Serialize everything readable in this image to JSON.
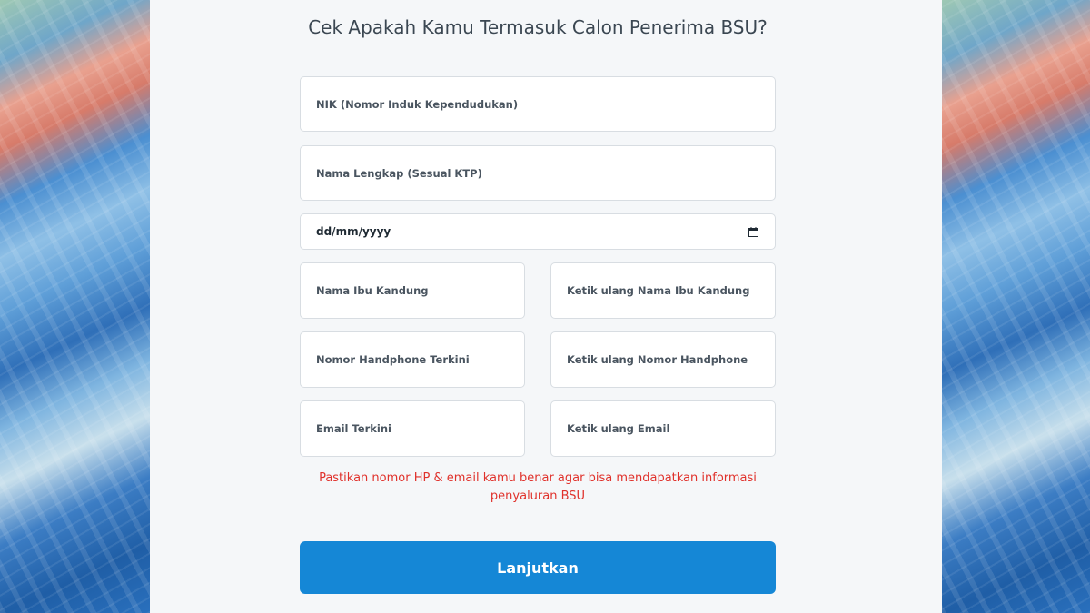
{
  "form": {
    "title": "Cek Apakah Kamu Termasuk Calon Penerima BSU?",
    "fields": {
      "nik": {
        "placeholder": "NIK (Nomor Induk Kependudukan)",
        "value": ""
      },
      "full_name": {
        "placeholder": "Nama Lengkap (Sesual KTP)",
        "value": ""
      },
      "birth_date": {
        "placeholder": "dd/mm/yyyy",
        "value": ""
      },
      "mother_name": {
        "placeholder": "Nama Ibu Kandung",
        "value": ""
      },
      "mother_name_confirm": {
        "placeholder": "Ketik ulang Nama Ibu Kandung",
        "value": ""
      },
      "phone": {
        "placeholder": "Nomor Handphone Terkini",
        "value": ""
      },
      "phone_confirm": {
        "placeholder": "Ketik ulang Nomor Handphone",
        "value": ""
      },
      "email": {
        "placeholder": "Email Terkini",
        "value": ""
      },
      "email_confirm": {
        "placeholder": "Ketik ulang Email",
        "value": ""
      }
    },
    "note": "Pastikan nomor HP & email kamu benar agar bisa mendapatkan informasi penyaluran BSU",
    "submit_label": "Lanjutkan"
  },
  "icons": {
    "date_picker": "calendar-icon"
  },
  "colors": {
    "panel_background": "#f5f7f9",
    "title_text": "#3b4752",
    "note_text": "#e0312b",
    "button_background": "#1587d6",
    "button_text": "#ffffff"
  }
}
